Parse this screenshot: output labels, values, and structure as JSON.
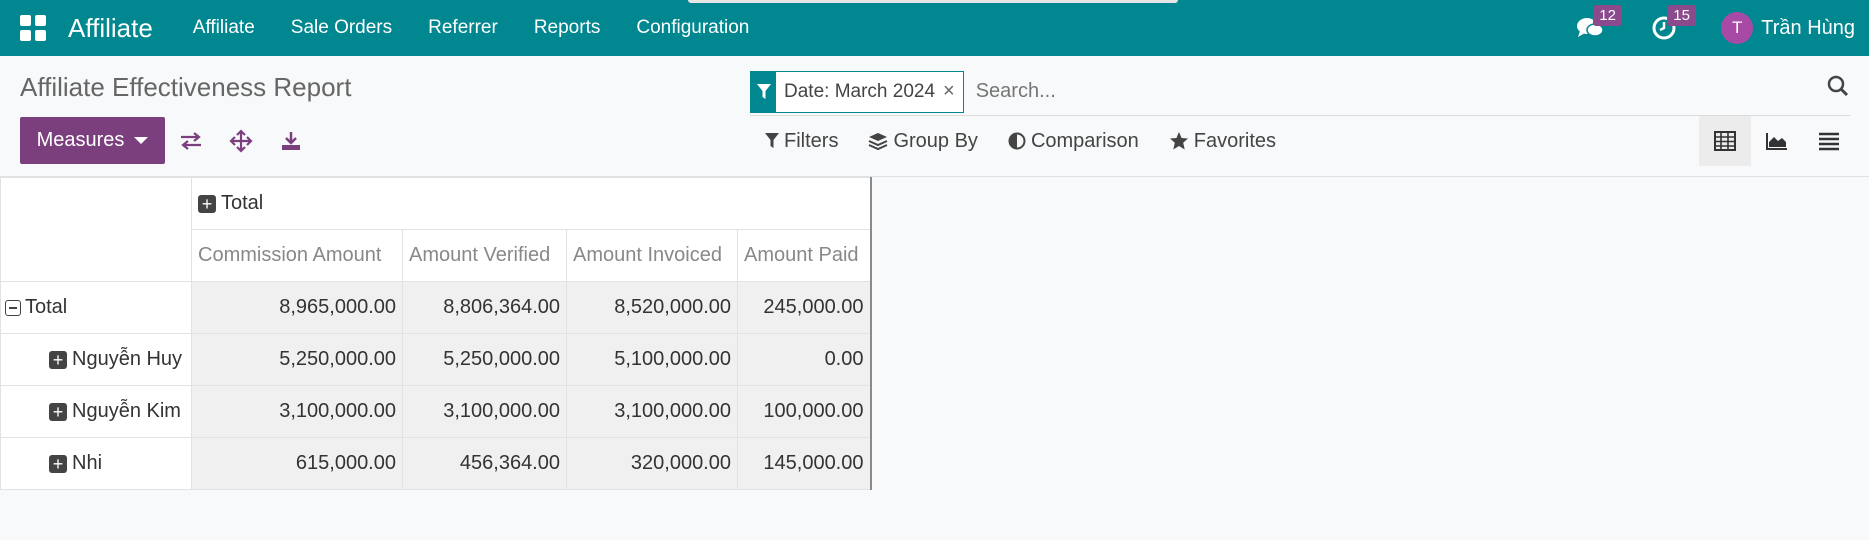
{
  "navbar": {
    "brand": "Affiliate",
    "menu": [
      "Affiliate",
      "Sale Orders",
      "Referrer",
      "Reports",
      "Configuration"
    ],
    "messages_count": "12",
    "activities_count": "15",
    "user_initial": "T",
    "user_name": "Trần Hùng",
    "color": "#00878f"
  },
  "control_panel": {
    "title": "Affiliate Effectiveness Report",
    "facet": "Date: March 2024",
    "facet_close": "×",
    "search_placeholder": "Search...",
    "measures_label": "Measures",
    "filters_label": "Filters",
    "group_by_label": "Group By",
    "comparison_label": "Comparison",
    "favorites_label": "Favorites",
    "accent": "#7c3f7e"
  },
  "pivot": {
    "col_header": "Total",
    "measures": [
      "Commission Amount",
      "Amount Verified",
      "Amount Invoiced",
      "Amount Paid"
    ],
    "total_row": {
      "label": "Total",
      "values": [
        "8,965,000.00",
        "8,806,364.00",
        "8,520,000.00",
        "245,000.00"
      ]
    },
    "rows": [
      {
        "label": "Nguyễn Huy",
        "values": [
          "5,250,000.00",
          "5,250,000.00",
          "5,100,000.00",
          "0.00"
        ]
      },
      {
        "label": "Nguyễn Kim",
        "values": [
          "3,100,000.00",
          "3,100,000.00",
          "3,100,000.00",
          "100,000.00"
        ]
      },
      {
        "label": "Nhi",
        "values": [
          "615,000.00",
          "456,364.00",
          "320,000.00",
          "145,000.00"
        ]
      }
    ]
  }
}
